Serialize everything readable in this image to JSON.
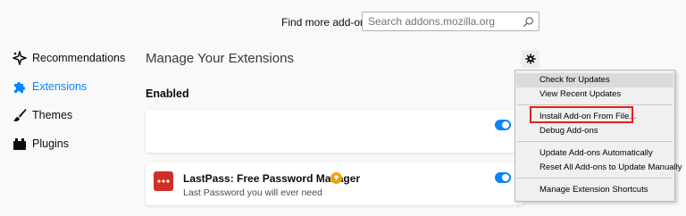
{
  "header": {
    "find_label": "Find more add-ons",
    "search_placeholder": "Search addons.mozilla.org"
  },
  "sidebar": {
    "items": [
      {
        "label": "Recommendations",
        "icon": "recommendations-icon"
      },
      {
        "label": "Extensions",
        "icon": "puzzle-icon",
        "active": true
      },
      {
        "label": "Themes",
        "icon": "brush-icon"
      },
      {
        "label": "Plugins",
        "icon": "plugin-icon"
      }
    ]
  },
  "main": {
    "title": "Manage Your Extensions",
    "section_heading": "Enabled",
    "extensions": [
      {
        "name": "",
        "description": "",
        "enabled": true
      },
      {
        "name": "LastPass: Free Password Manager",
        "description": "Last Password you will ever need",
        "enabled": true
      }
    ]
  },
  "menu": {
    "items": [
      {
        "label": "Check for Updates"
      },
      {
        "label": "View Recent Updates"
      },
      {
        "label": "Install Add-on From File..."
      },
      {
        "label": "Debug Add-ons"
      },
      {
        "label": "Update Add-ons Automatically"
      },
      {
        "label": "Reset All Add-ons to Update Manually"
      },
      {
        "label": "Manage Extension Shortcuts"
      }
    ]
  },
  "colors": {
    "accent": "#0a84ff",
    "lastpass_red": "#d32d27",
    "highlight_box": "#e2211c"
  }
}
